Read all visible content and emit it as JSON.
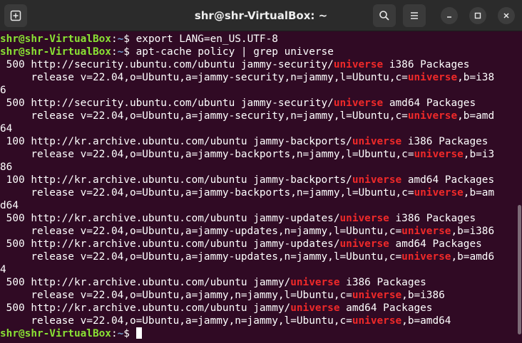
{
  "titlebar": {
    "title": "shr@shr-VirtualBox: ~"
  },
  "prompt": {
    "user_host": "shr@shr-VirtualBox",
    "sep": ":",
    "path": "~",
    "symbol": "$"
  },
  "commands": [
    " export LANG=en_US.UTF-8",
    " apt-cache policy | grep universe"
  ],
  "output": [
    [
      " 500 http://security.ubuntu.com/ubuntu jammy-security/",
      "universe",
      " i386 Packages"
    ],
    [
      "     release v=22.04,o=Ubuntu,a=jammy-security,n=jammy,l=Ubuntu,c=",
      "universe",
      ",b=i38"
    ],
    [
      "6"
    ],
    [
      " 500 http://security.ubuntu.com/ubuntu jammy-security/",
      "universe",
      " amd64 Packages"
    ],
    [
      "     release v=22.04,o=Ubuntu,a=jammy-security,n=jammy,l=Ubuntu,c=",
      "universe",
      ",b=amd"
    ],
    [
      "64"
    ],
    [
      " 100 http://kr.archive.ubuntu.com/ubuntu jammy-backports/",
      "universe",
      " i386 Packages"
    ],
    [
      "     release v=22.04,o=Ubuntu,a=jammy-backports,n=jammy,l=Ubuntu,c=",
      "universe",
      ",b=i3"
    ],
    [
      "86"
    ],
    [
      " 100 http://kr.archive.ubuntu.com/ubuntu jammy-backports/",
      "universe",
      " amd64 Packages"
    ],
    [
      "     release v=22.04,o=Ubuntu,a=jammy-backports,n=jammy,l=Ubuntu,c=",
      "universe",
      ",b=am"
    ],
    [
      "d64"
    ],
    [
      " 500 http://kr.archive.ubuntu.com/ubuntu jammy-updates/",
      "universe",
      " i386 Packages"
    ],
    [
      "     release v=22.04,o=Ubuntu,a=jammy-updates,n=jammy,l=Ubuntu,c=",
      "universe",
      ",b=i386"
    ],
    [
      " 500 http://kr.archive.ubuntu.com/ubuntu jammy-updates/",
      "universe",
      " amd64 Packages"
    ],
    [
      "     release v=22.04,o=Ubuntu,a=jammy-updates,n=jammy,l=Ubuntu,c=",
      "universe",
      ",b=amd6"
    ],
    [
      "4"
    ],
    [
      " 500 http://kr.archive.ubuntu.com/ubuntu jammy/",
      "universe",
      " i386 Packages"
    ],
    [
      "     release v=22.04,o=Ubuntu,a=jammy,n=jammy,l=Ubuntu,c=",
      "universe",
      ",b=i386"
    ],
    [
      " 500 http://kr.archive.ubuntu.com/ubuntu jammy/",
      "universe",
      " amd64 Packages"
    ],
    [
      "     release v=22.04,o=Ubuntu,a=jammy,n=jammy,l=Ubuntu,c=",
      "universe",
      ",b=amd64"
    ]
  ],
  "icons": {
    "new_tab": "new-tab-icon",
    "search": "search-icon",
    "menu": "hamburger-menu-icon",
    "minimize": "minimize-icon",
    "maximize": "maximize-icon",
    "close": "close-icon"
  },
  "colors": {
    "background": "#300a24",
    "titlebar": "#2b2b2b",
    "prompt_user": "#8ae234",
    "prompt_path": "#729fcf",
    "match_highlight": "#ef2929",
    "text": "#ffffff"
  }
}
